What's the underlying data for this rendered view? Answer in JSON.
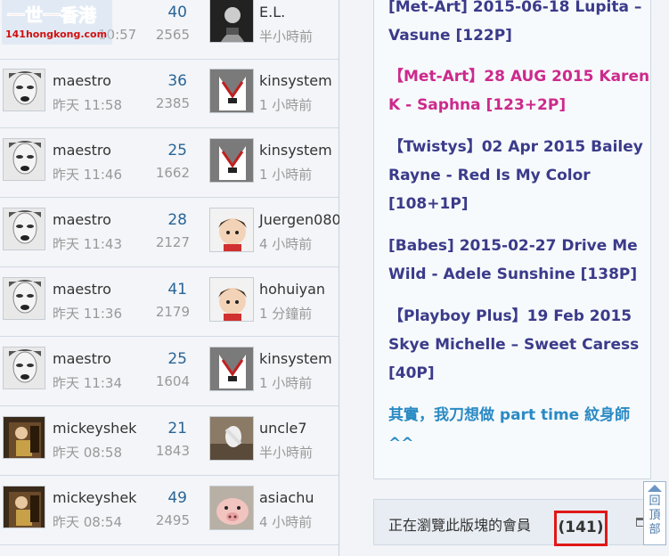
{
  "site_logo": {
    "line1": "一世一香港",
    "line2": "141hongkong.com"
  },
  "threads": [
    {
      "author": "",
      "author_time": "10:57",
      "replies": "40",
      "views": "2565",
      "last_poster": "E.L.",
      "last_time": "半小時前"
    },
    {
      "author": "maestro",
      "author_time": "昨天 11:58",
      "replies": "36",
      "views": "2385",
      "last_poster": "kinsystem",
      "last_time": "1 小時前"
    },
    {
      "author": "maestro",
      "author_time": "昨天 11:46",
      "replies": "25",
      "views": "1662",
      "last_poster": "kinsystem",
      "last_time": "1 小時前"
    },
    {
      "author": "maestro",
      "author_time": "昨天 11:43",
      "replies": "28",
      "views": "2127",
      "last_poster": "Juergen080",
      "last_time": "4 小時前"
    },
    {
      "author": "maestro",
      "author_time": "昨天 11:36",
      "replies": "41",
      "views": "2179",
      "last_poster": "hohuiyan",
      "last_time": "1 分鐘前"
    },
    {
      "author": "maestro",
      "author_time": "昨天 11:34",
      "replies": "25",
      "views": "1604",
      "last_poster": "kinsystem",
      "last_time": "1 小時前"
    },
    {
      "author": "mickeyshek",
      "author_time": "昨天 08:58",
      "replies": "21",
      "views": "1843",
      "last_poster": "uncle7",
      "last_time": "半小時前"
    },
    {
      "author": "mickeyshek",
      "author_time": "昨天 08:54",
      "replies": "49",
      "views": "2495",
      "last_poster": "asiachu",
      "last_time": "4 小時前"
    }
  ],
  "hot_posts": [
    {
      "title": "[Met-Art] 2015-06-18 Lupita – Vasune [122P]",
      "style": "normal"
    },
    {
      "title": "【Met-Art】28 AUG 2015 Karen K - Saphna [123+2P]",
      "style": "pink"
    },
    {
      "title": "【Twistys】02 Apr 2015 Bailey Rayne - Red Is My Color [108+1P]",
      "style": "normal"
    },
    {
      "title": "[Babes] 2015-02-27 Drive Me Wild - Adele Sunshine [138P]",
      "style": "normal"
    },
    {
      "title": "【Playboy Plus】19 Feb 2015 Skye Michelle – Sweet Caress [40P]",
      "style": "normal"
    },
    {
      "title": "其實，我刀想做 part time 紋身師 ^^",
      "style": "teal"
    }
  ],
  "members_panel": {
    "label": "正在瀏覽此版塊的會員",
    "count": "(141)"
  },
  "back_to_top": "回頂部",
  "colors": {
    "accent": "#2a6496",
    "pink": "#cc2a8c",
    "highlight_box": "#e01818"
  }
}
